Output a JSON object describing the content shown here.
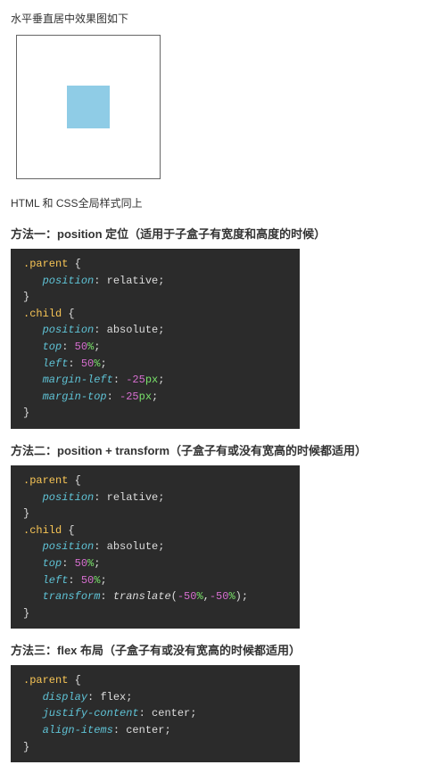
{
  "intro": "水平垂直居中效果图如下",
  "subnote": "HTML 和 CSS全局样式同上",
  "methods": [
    {
      "title": "方法一：position 定位（适用于子盒子有宽度和高度的时候）",
      "code": {
        "parent_sel": ".parent",
        "parent_decl": {
          "prop": "position",
          "val": "relative"
        },
        "child_sel": ".child",
        "child_decls": [
          {
            "prop": "position",
            "val": "absolute"
          },
          {
            "prop": "top",
            "num": "50",
            "unit": "%"
          },
          {
            "prop": "left",
            "num": "50",
            "unit": "%"
          },
          {
            "prop": "margin-left",
            "num": "-25",
            "unit": "px"
          },
          {
            "prop": "margin-top",
            "num": "-25",
            "unit": "px"
          }
        ]
      }
    },
    {
      "title": "方法二：position + transform（子盒子有或没有宽高的时候都适用）",
      "code": {
        "parent_sel": ".parent",
        "parent_decl": {
          "prop": "position",
          "val": "relative"
        },
        "child_sel": ".child",
        "child_decls": [
          {
            "prop": "position",
            "val": "absolute"
          },
          {
            "prop": "top",
            "num": "50",
            "unit": "%"
          },
          {
            "prop": "left",
            "num": "50",
            "unit": "%"
          },
          {
            "prop": "transform",
            "fn": "translate",
            "args": [
              {
                "num": "-50",
                "unit": "%"
              },
              {
                "num": "-50",
                "unit": "%"
              }
            ]
          }
        ]
      }
    },
    {
      "title": "方法三：flex 布局（子盒子有或没有宽高的时候都适用）",
      "code": {
        "parent_sel": ".parent",
        "parent_decls": [
          {
            "prop": "display",
            "val": "flex"
          },
          {
            "prop": "justify-content",
            "val": "center"
          },
          {
            "prop": "align-items",
            "val": "center"
          }
        ]
      }
    }
  ]
}
